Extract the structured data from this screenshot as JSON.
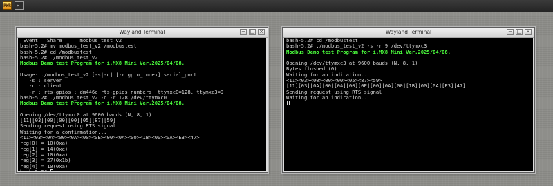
{
  "topbar": {
    "launcher_icon": "weston-launcher-icon",
    "launcher_text": "PWR",
    "terminal_icon": "terminal-launcher-icon",
    "terminal_text": ">_"
  },
  "left_window": {
    "title": "Wayland Terminal",
    "buttons": {
      "minimize": "−",
      "maximize": "□",
      "close": "×"
    },
    "lines": [
      {
        "text": " Event   Share      modbus_test_v2",
        "hl": false
      },
      {
        "text": "bash-5.2# mv modbus_test_v2 /modbustest",
        "hl": false
      },
      {
        "text": "bash-5.2# cd /modbustest",
        "hl": false
      },
      {
        "text": "bash-5.2# ./modbus_test_v2",
        "hl": false
      },
      {
        "text": "Modbus Demo test Program for i.MX8 Mini Ver.2025/04/08.",
        "hl": true
      },
      {
        "text": "",
        "hl": false
      },
      {
        "text": "Usage: ./modbus_test_v2 [-s|-c] [-r gpio_index] serial_port",
        "hl": false
      },
      {
        "text": "   -s : server",
        "hl": false
      },
      {
        "text": "   -c : client",
        "hl": false
      },
      {
        "text": "   -r : rts-gpios : dm446c rts-gpios numbers: ttymxc0=128, ttymxc3=9",
        "hl": false
      },
      {
        "text": "bash-5.2# ./modbus_test_v2 -c -r 128 /dev/ttymxc0",
        "hl": false
      },
      {
        "text": "Modbus Demo test Program for i.MX8 Mini Ver.2025/04/08.",
        "hl": true
      },
      {
        "text": "",
        "hl": false
      },
      {
        "text": "Opening /dev/ttymxc0 at 9600 bauds (N, 8, 1)",
        "hl": false
      },
      {
        "text": "[11][03][00][00][00][05][87][59]",
        "hl": false
      },
      {
        "text": "Sending request using RTS signal",
        "hl": false
      },
      {
        "text": "Waiting for a confirmation...",
        "hl": false
      },
      {
        "text": "<11><03><0A><00><0A><00><0E><00><0A><00><1B><00><0A><E3><47>",
        "hl": false
      },
      {
        "text": "reg[0] = 10(0xa)",
        "hl": false
      },
      {
        "text": "reg[1] = 14(0xe)",
        "hl": false
      },
      {
        "text": "reg[2] = 10(0xa)",
        "hl": false
      },
      {
        "text": "reg[3] = 27(0x1b)",
        "hl": false
      },
      {
        "text": "reg[4] = 10(0xa)",
        "hl": false
      },
      {
        "text": "bash-5.2# ",
        "hl": false,
        "cursor": true
      }
    ]
  },
  "right_window": {
    "title": "Wayland Terminal",
    "buttons": {
      "minimize": "−",
      "maximize": "□",
      "close": "×"
    },
    "lines": [
      {
        "text": "bash-5.2# cd /modbustest",
        "hl": false
      },
      {
        "text": "bash-5.2# ./modbus_test_v2 -s -r 9 /dev/ttymxc3",
        "hl": false
      },
      {
        "text": "Modbus Demo test Program for i.MX8 Mini Ver.2025/04/08.",
        "hl": true
      },
      {
        "text": "",
        "hl": false
      },
      {
        "text": "Opening /dev/ttymxc3 at 9600 bauds (N, 8, 1)",
        "hl": false
      },
      {
        "text": "Bytes flushed (0)",
        "hl": false
      },
      {
        "text": "Waiting for an indication...",
        "hl": false
      },
      {
        "text": "<11><03><00><00><00><05><87><59>",
        "hl": false
      },
      {
        "text": "[11][03][0A][00][0A][00][0E][00][0A][00][1B][00][0A][E3][47]",
        "hl": false
      },
      {
        "text": "Sending request using RTS signal",
        "hl": false
      },
      {
        "text": "Waiting for an indication...",
        "hl": false
      },
      {
        "text": "",
        "hl": false,
        "cursor": true
      }
    ]
  },
  "colors": {
    "desktop": "#8e8e8a",
    "terminal_bg": "#000000",
    "terminal_fg": "#d6d6d6",
    "highlight": "#4cff3d"
  }
}
